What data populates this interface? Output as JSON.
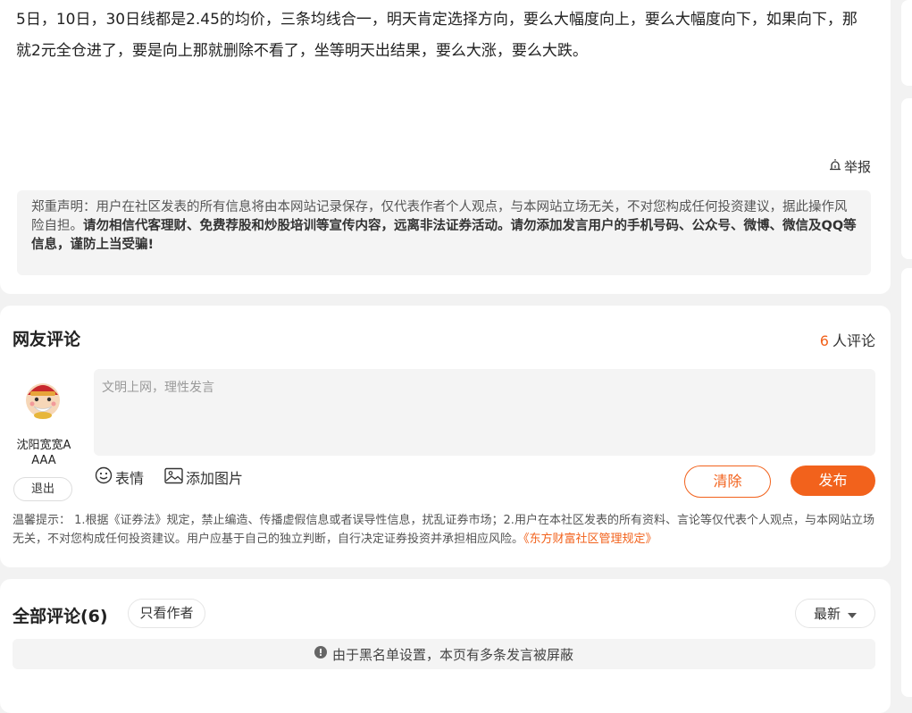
{
  "post": {
    "body": "5日，10日，30日线都是2.45的均价，三条均线合一，明天肯定选择方向，要么大幅度向上，要么大幅度向下，如果向下，那就2元全仓进了，要是向上那就删除不看了，坐等明天出结果，要么大涨，要么大跌。",
    "report_label": "举报"
  },
  "disclaimer": {
    "normal": "郑重声明：用户在社区发表的所有信息将由本网站记录保存，仅代表作者个人观点，与本网站立场无关，不对您构成任何投资建议，据此操作风险自担。",
    "bold": "请勿相信代客理财、免费荐股和炒股培训等宣传内容，远离非法证券活动。请勿添加发言用户的手机号码、公众号、微博、微信及QQ等信息，谨防上当受骗!"
  },
  "comment_section": {
    "title": "网友评论",
    "count_num": "6",
    "count_suffix": "人评论",
    "username": "沈阳宽宽AAAA",
    "logout_label": "退出",
    "placeholder": "文明上网，理性发言",
    "emoji_label": "表情",
    "image_label": "添加图片",
    "clear_label": "清除",
    "submit_label": "发布",
    "tips_text": "温馨提示： 1.根据《证券法》规定，禁止编造、传播虚假信息或者误导性信息，扰乱证券市场；2.用户在本社区发表的所有资料、言论等仅代表个人观点，与本网站立场无关，不对您构成任何投资建议。用户应基于自己的独立判断，自行决定证券投资并承担相应风险。",
    "tips_link": "《东方财富社区管理规定》"
  },
  "all_comments": {
    "title": "全部评论(6)",
    "only_author_label": "只看作者",
    "sort_label": "最新",
    "blocked_notice": "由于黑名单设置，本页有多条发言被屏蔽"
  },
  "colors": {
    "accent": "#f2621c",
    "page_bg": "#f2f2f2",
    "panel_bg": "#f4f4f4"
  },
  "icons": {
    "report": "bell-alarm-icon",
    "emoji": "smiley-icon",
    "image": "image-icon",
    "sort": "caret-down-icon",
    "notice": "info-circle-icon"
  }
}
